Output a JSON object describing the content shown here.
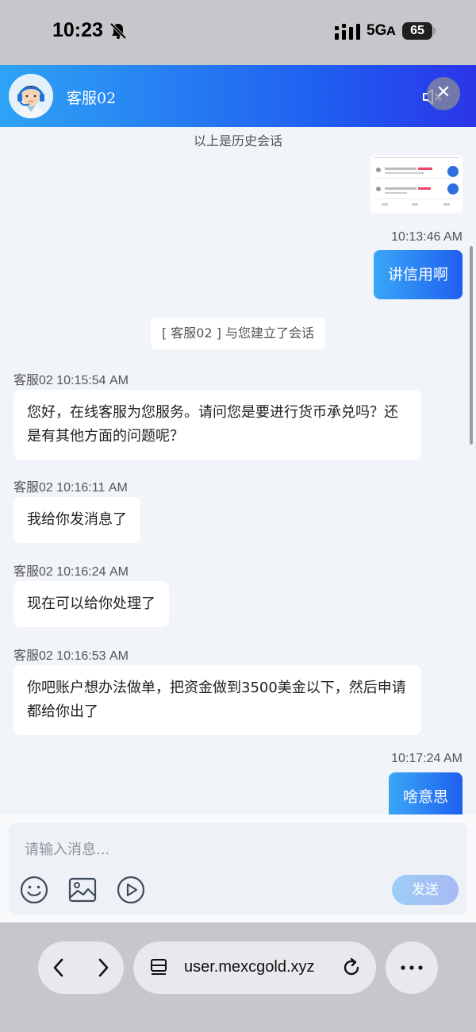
{
  "status": {
    "time": "10:23",
    "network": "5Gᴀ",
    "battery": "65"
  },
  "header": {
    "agent_name": "客服02"
  },
  "chat": {
    "history_note": "以上是历史会话",
    "system_message": "[ 客服02 ] 与您建立了会话",
    "messages": [
      {
        "direction": "out",
        "time": "10:13:46 AM",
        "text": "讲信用啊"
      },
      {
        "direction": "in",
        "time": "客服02 10:15:54 AM",
        "text": "您好，在线客服为您服务。请问您是要进行货币承兑吗？还是有其他方面的问题呢？"
      },
      {
        "direction": "in",
        "time": "客服02 10:16:11 AM",
        "text": "我给你发消息了"
      },
      {
        "direction": "in",
        "time": "客服02 10:16:24 AM",
        "text": "现在可以给你处理了"
      },
      {
        "direction": "in",
        "time": "客服02 10:16:53 AM",
        "text": "你吧账户想办法做单，把资金做到3500美金以下，然后申请都给你出了"
      },
      {
        "direction": "out",
        "time": "10:17:24 AM",
        "text": "啥意思"
      }
    ]
  },
  "composer": {
    "placeholder": "请输入消息...",
    "send_label": "发送"
  },
  "browser": {
    "url": "user.mexcgold.xyz"
  },
  "colors": {
    "header_gradient_start": "#2ea3f5",
    "header_gradient_end": "#2a35e8",
    "outgoing_bubble": "#1f5ff0",
    "chat_background": "#f1f4f8"
  }
}
